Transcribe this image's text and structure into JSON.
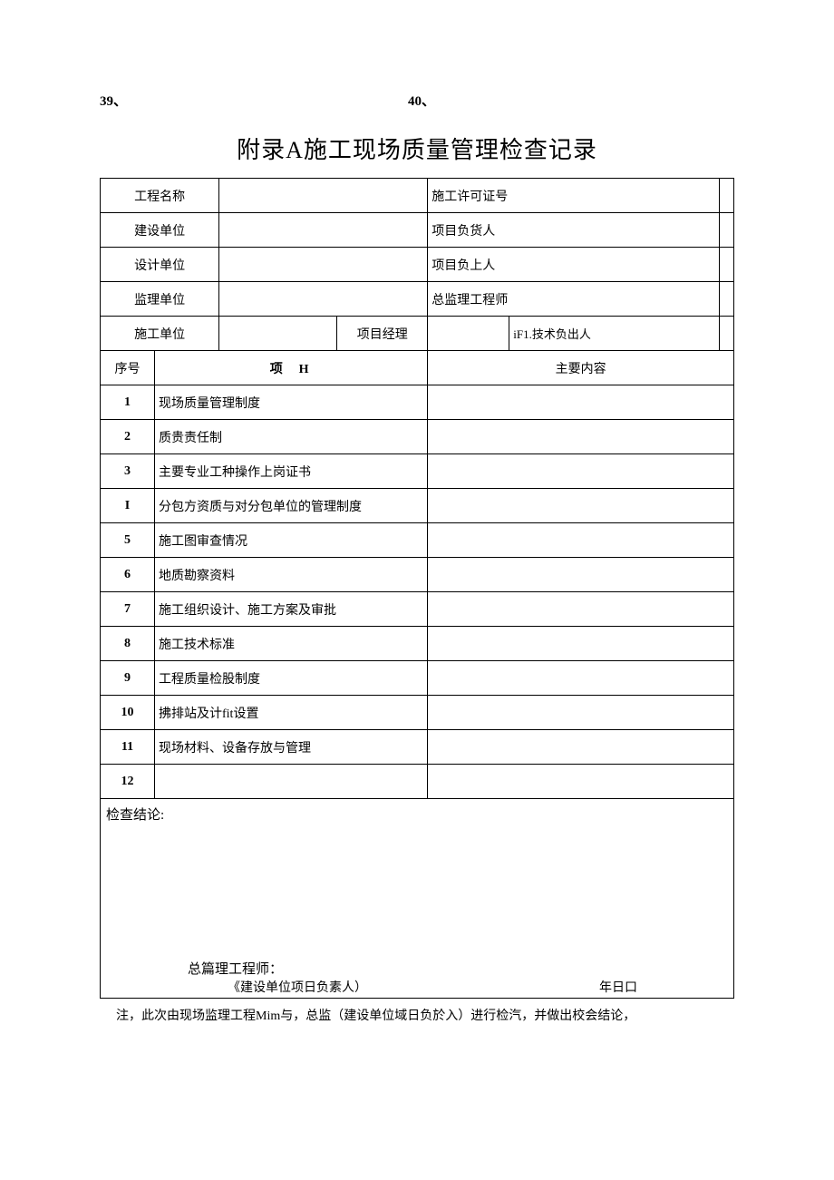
{
  "topNums": {
    "n1": "39、",
    "n2": "40、"
  },
  "title": "附录A施工现场质量管理检查记录",
  "header": {
    "row1": {
      "l1": "工程名称",
      "v1": "",
      "l2": "施工许可证号",
      "v2": ""
    },
    "row2": {
      "l1": "建设单位",
      "v1": "",
      "l2": "项目负货人",
      "v2": ""
    },
    "row3": {
      "l1": "设计单位",
      "v1": "",
      "l2": "项目负上人",
      "v2": ""
    },
    "row4": {
      "l1": "监理单位",
      "v1": "",
      "l2": "总监理工程师",
      "v2": ""
    },
    "row5": {
      "l1": "施工单位",
      "v1": "",
      "l2": "项目经理",
      "v2": "",
      "l3": "iF1.技术负出人",
      "v3": ""
    }
  },
  "columns": {
    "seq": "序号",
    "item": "项H",
    "content": "主要内容"
  },
  "rows": [
    {
      "seq": "1",
      "item": "现场质量管理制度",
      "content": ""
    },
    {
      "seq": "2",
      "item": "质贵责任制",
      "content": ""
    },
    {
      "seq": "3",
      "item": "主要专业工种操作上岗证书",
      "content": ""
    },
    {
      "seq": "I",
      "item": "分包方资质与对分包单位的管理制度",
      "content": ""
    },
    {
      "seq": "5",
      "item": "施工图审查情况",
      "content": ""
    },
    {
      "seq": "6",
      "item": "地质勘察资料",
      "content": ""
    },
    {
      "seq": "7",
      "item": "施工组织设计、施工方案及审批",
      "content": ""
    },
    {
      "seq": "8",
      "item": "施工技术标准",
      "content": ""
    },
    {
      "seq": "9",
      "item": "工程质量检股制度",
      "content": ""
    },
    {
      "seq": "10",
      "item": "拂排站及计fit设置",
      "content": ""
    },
    {
      "seq": "11",
      "item": "现场材料、设备存放与管理",
      "content": ""
    },
    {
      "seq": "12",
      "item": "",
      "content": ""
    }
  ],
  "conclusion": {
    "label": "检查结论:",
    "signLine": "总篇理工程师：",
    "subLine": "《建设单位项日负素人）",
    "dateLine": "年日口"
  },
  "note": "注，此次由现场监理工程Mim与，总监（建设单位域日负於入）进行检汽，并做出校会结论，"
}
